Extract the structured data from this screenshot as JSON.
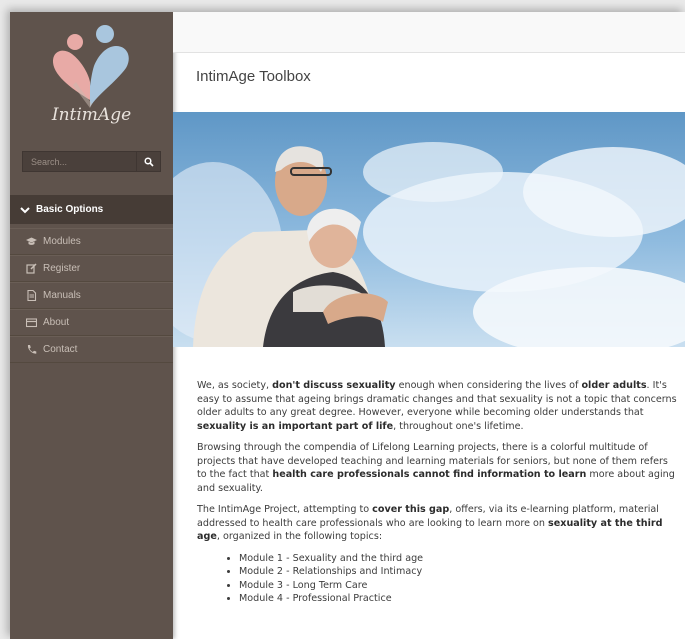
{
  "app": {
    "logo_text": "IntimAge",
    "page_title": "IntimAge Toolbox"
  },
  "search": {
    "placeholder": "Search..."
  },
  "nav": {
    "header": "Basic Options",
    "items": [
      {
        "label": "Modules",
        "icon": "graduation-cap-icon"
      },
      {
        "label": "Register",
        "icon": "edit-icon"
      },
      {
        "label": "Manuals",
        "icon": "document-icon"
      },
      {
        "label": "About",
        "icon": "card-icon"
      },
      {
        "label": "Contact",
        "icon": "phone-icon"
      }
    ]
  },
  "content": {
    "p1": {
      "a": "We, as society, ",
      "b1": "don't discuss sexuality",
      "c": " enough when considering the lives of ",
      "b2": "older adults",
      "d": ". It's easy to assume that ageing brings dramatic changes and that sexuality is not a topic that concerns older adults to any great degree. However, everyone while becoming older understands that ",
      "b3": "sexuality is an important part of life",
      "e": ", throughout one's lifetime."
    },
    "p2": {
      "a": "Browsing through the compendia of Lifelong Learning projects, there is a colorful multitude of projects that have developed teaching and learning materials for seniors, but none of them refers to the fact that ",
      "b1": "health care professionals cannot find information to learn",
      "c": " more about aging and sexuality."
    },
    "p3": {
      "a": "The IntimAge Project, attempting to ",
      "b1": "cover this gap",
      "c": ", offers, via its e-learning platform, material addressed to health care professionals who are looking to learn more on ",
      "b2": "sexuality at the third age",
      "d": ", organized in the following topics:"
    },
    "modules": [
      "Module 1 - Sexuality and the third age",
      "Module 2 - Relationships and Intimacy",
      "Module 3 - Long Term Care",
      "Module 4 - Professional Practice"
    ]
  },
  "colors": {
    "sidebar": "#5f534c",
    "nav_header": "#463c36",
    "logo_pink": "#e8aaa6",
    "logo_blue": "#a9c6de"
  }
}
